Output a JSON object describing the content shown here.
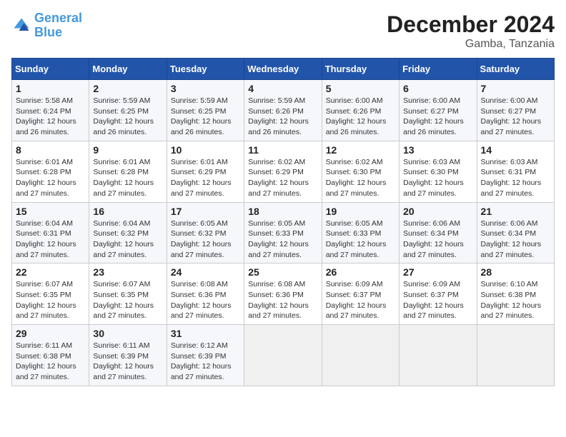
{
  "header": {
    "logo_line1": "General",
    "logo_line2": "Blue",
    "title": "December 2024",
    "subtitle": "Gamba, Tanzania"
  },
  "days_of_week": [
    "Sunday",
    "Monday",
    "Tuesday",
    "Wednesday",
    "Thursday",
    "Friday",
    "Saturday"
  ],
  "weeks": [
    [
      {
        "day": "1",
        "info": "Sunrise: 5:58 AM\nSunset: 6:24 PM\nDaylight: 12 hours\nand 26 minutes."
      },
      {
        "day": "2",
        "info": "Sunrise: 5:59 AM\nSunset: 6:25 PM\nDaylight: 12 hours\nand 26 minutes."
      },
      {
        "day": "3",
        "info": "Sunrise: 5:59 AM\nSunset: 6:25 PM\nDaylight: 12 hours\nand 26 minutes."
      },
      {
        "day": "4",
        "info": "Sunrise: 5:59 AM\nSunset: 6:26 PM\nDaylight: 12 hours\nand 26 minutes."
      },
      {
        "day": "5",
        "info": "Sunrise: 6:00 AM\nSunset: 6:26 PM\nDaylight: 12 hours\nand 26 minutes."
      },
      {
        "day": "6",
        "info": "Sunrise: 6:00 AM\nSunset: 6:27 PM\nDaylight: 12 hours\nand 26 minutes."
      },
      {
        "day": "7",
        "info": "Sunrise: 6:00 AM\nSunset: 6:27 PM\nDaylight: 12 hours\nand 27 minutes."
      }
    ],
    [
      {
        "day": "8",
        "info": "Sunrise: 6:01 AM\nSunset: 6:28 PM\nDaylight: 12 hours\nand 27 minutes."
      },
      {
        "day": "9",
        "info": "Sunrise: 6:01 AM\nSunset: 6:28 PM\nDaylight: 12 hours\nand 27 minutes."
      },
      {
        "day": "10",
        "info": "Sunrise: 6:01 AM\nSunset: 6:29 PM\nDaylight: 12 hours\nand 27 minutes."
      },
      {
        "day": "11",
        "info": "Sunrise: 6:02 AM\nSunset: 6:29 PM\nDaylight: 12 hours\nand 27 minutes."
      },
      {
        "day": "12",
        "info": "Sunrise: 6:02 AM\nSunset: 6:30 PM\nDaylight: 12 hours\nand 27 minutes."
      },
      {
        "day": "13",
        "info": "Sunrise: 6:03 AM\nSunset: 6:30 PM\nDaylight: 12 hours\nand 27 minutes."
      },
      {
        "day": "14",
        "info": "Sunrise: 6:03 AM\nSunset: 6:31 PM\nDaylight: 12 hours\nand 27 minutes."
      }
    ],
    [
      {
        "day": "15",
        "info": "Sunrise: 6:04 AM\nSunset: 6:31 PM\nDaylight: 12 hours\nand 27 minutes."
      },
      {
        "day": "16",
        "info": "Sunrise: 6:04 AM\nSunset: 6:32 PM\nDaylight: 12 hours\nand 27 minutes."
      },
      {
        "day": "17",
        "info": "Sunrise: 6:05 AM\nSunset: 6:32 PM\nDaylight: 12 hours\nand 27 minutes."
      },
      {
        "day": "18",
        "info": "Sunrise: 6:05 AM\nSunset: 6:33 PM\nDaylight: 12 hours\nand 27 minutes."
      },
      {
        "day": "19",
        "info": "Sunrise: 6:05 AM\nSunset: 6:33 PM\nDaylight: 12 hours\nand 27 minutes."
      },
      {
        "day": "20",
        "info": "Sunrise: 6:06 AM\nSunset: 6:34 PM\nDaylight: 12 hours\nand 27 minutes."
      },
      {
        "day": "21",
        "info": "Sunrise: 6:06 AM\nSunset: 6:34 PM\nDaylight: 12 hours\nand 27 minutes."
      }
    ],
    [
      {
        "day": "22",
        "info": "Sunrise: 6:07 AM\nSunset: 6:35 PM\nDaylight: 12 hours\nand 27 minutes."
      },
      {
        "day": "23",
        "info": "Sunrise: 6:07 AM\nSunset: 6:35 PM\nDaylight: 12 hours\nand 27 minutes."
      },
      {
        "day": "24",
        "info": "Sunrise: 6:08 AM\nSunset: 6:36 PM\nDaylight: 12 hours\nand 27 minutes."
      },
      {
        "day": "25",
        "info": "Sunrise: 6:08 AM\nSunset: 6:36 PM\nDaylight: 12 hours\nand 27 minutes."
      },
      {
        "day": "26",
        "info": "Sunrise: 6:09 AM\nSunset: 6:37 PM\nDaylight: 12 hours\nand 27 minutes."
      },
      {
        "day": "27",
        "info": "Sunrise: 6:09 AM\nSunset: 6:37 PM\nDaylight: 12 hours\nand 27 minutes."
      },
      {
        "day": "28",
        "info": "Sunrise: 6:10 AM\nSunset: 6:38 PM\nDaylight: 12 hours\nand 27 minutes."
      }
    ],
    [
      {
        "day": "29",
        "info": "Sunrise: 6:11 AM\nSunset: 6:38 PM\nDaylight: 12 hours\nand 27 minutes."
      },
      {
        "day": "30",
        "info": "Sunrise: 6:11 AM\nSunset: 6:39 PM\nDaylight: 12 hours\nand 27 minutes."
      },
      {
        "day": "31",
        "info": "Sunrise: 6:12 AM\nSunset: 6:39 PM\nDaylight: 12 hours\nand 27 minutes."
      },
      null,
      null,
      null,
      null
    ]
  ]
}
